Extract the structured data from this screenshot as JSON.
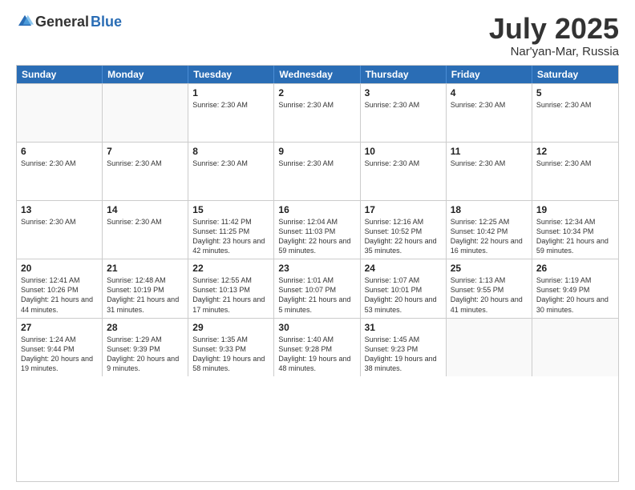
{
  "header": {
    "logo_general": "General",
    "logo_blue": "Blue",
    "month": "July 2025",
    "location": "Nar'yan-Mar, Russia"
  },
  "weekdays": [
    "Sunday",
    "Monday",
    "Tuesday",
    "Wednesday",
    "Thursday",
    "Friday",
    "Saturday"
  ],
  "weeks": [
    [
      {
        "day": "",
        "info": ""
      },
      {
        "day": "",
        "info": ""
      },
      {
        "day": "1",
        "info": "Sunrise: 2:30 AM"
      },
      {
        "day": "2",
        "info": "Sunrise: 2:30 AM"
      },
      {
        "day": "3",
        "info": "Sunrise: 2:30 AM"
      },
      {
        "day": "4",
        "info": "Sunrise: 2:30 AM"
      },
      {
        "day": "5",
        "info": "Sunrise: 2:30 AM"
      }
    ],
    [
      {
        "day": "6",
        "info": "Sunrise: 2:30 AM"
      },
      {
        "day": "7",
        "info": "Sunrise: 2:30 AM"
      },
      {
        "day": "8",
        "info": "Sunrise: 2:30 AM"
      },
      {
        "day": "9",
        "info": "Sunrise: 2:30 AM"
      },
      {
        "day": "10",
        "info": "Sunrise: 2:30 AM"
      },
      {
        "day": "11",
        "info": "Sunrise: 2:30 AM"
      },
      {
        "day": "12",
        "info": "Sunrise: 2:30 AM"
      }
    ],
    [
      {
        "day": "13",
        "info": "Sunrise: 2:30 AM"
      },
      {
        "day": "14",
        "info": "Sunrise: 2:30 AM"
      },
      {
        "day": "15",
        "info": "Sunrise: 11:42 PM\nSunset: 11:25 PM\nDaylight: 23 hours and 42 minutes."
      },
      {
        "day": "16",
        "info": "Sunrise: 12:04 AM\nSunset: 11:03 PM\nDaylight: 22 hours and 59 minutes."
      },
      {
        "day": "17",
        "info": "Sunrise: 12:16 AM\nSunset: 10:52 PM\nDaylight: 22 hours and 35 minutes."
      },
      {
        "day": "18",
        "info": "Sunrise: 12:25 AM\nSunset: 10:42 PM\nDaylight: 22 hours and 16 minutes."
      },
      {
        "day": "19",
        "info": "Sunrise: 12:34 AM\nSunset: 10:34 PM\nDaylight: 21 hours and 59 minutes."
      }
    ],
    [
      {
        "day": "20",
        "info": "Sunrise: 12:41 AM\nSunset: 10:26 PM\nDaylight: 21 hours and 44 minutes."
      },
      {
        "day": "21",
        "info": "Sunrise: 12:48 AM\nSunset: 10:19 PM\nDaylight: 21 hours and 31 minutes."
      },
      {
        "day": "22",
        "info": "Sunrise: 12:55 AM\nSunset: 10:13 PM\nDaylight: 21 hours and 17 minutes."
      },
      {
        "day": "23",
        "info": "Sunrise: 1:01 AM\nSunset: 10:07 PM\nDaylight: 21 hours and 5 minutes."
      },
      {
        "day": "24",
        "info": "Sunrise: 1:07 AM\nSunset: 10:01 PM\nDaylight: 20 hours and 53 minutes."
      },
      {
        "day": "25",
        "info": "Sunrise: 1:13 AM\nSunset: 9:55 PM\nDaylight: 20 hours and 41 minutes."
      },
      {
        "day": "26",
        "info": "Sunrise: 1:19 AM\nSunset: 9:49 PM\nDaylight: 20 hours and 30 minutes."
      }
    ],
    [
      {
        "day": "27",
        "info": "Sunrise: 1:24 AM\nSunset: 9:44 PM\nDaylight: 20 hours and 19 minutes."
      },
      {
        "day": "28",
        "info": "Sunrise: 1:29 AM\nSunset: 9:39 PM\nDaylight: 20 hours and 9 minutes."
      },
      {
        "day": "29",
        "info": "Sunrise: 1:35 AM\nSunset: 9:33 PM\nDaylight: 19 hours and 58 minutes."
      },
      {
        "day": "30",
        "info": "Sunrise: 1:40 AM\nSunset: 9:28 PM\nDaylight: 19 hours and 48 minutes."
      },
      {
        "day": "31",
        "info": "Sunrise: 1:45 AM\nSunset: 9:23 PM\nDaylight: 19 hours and 38 minutes."
      },
      {
        "day": "",
        "info": ""
      },
      {
        "day": "",
        "info": ""
      }
    ]
  ]
}
